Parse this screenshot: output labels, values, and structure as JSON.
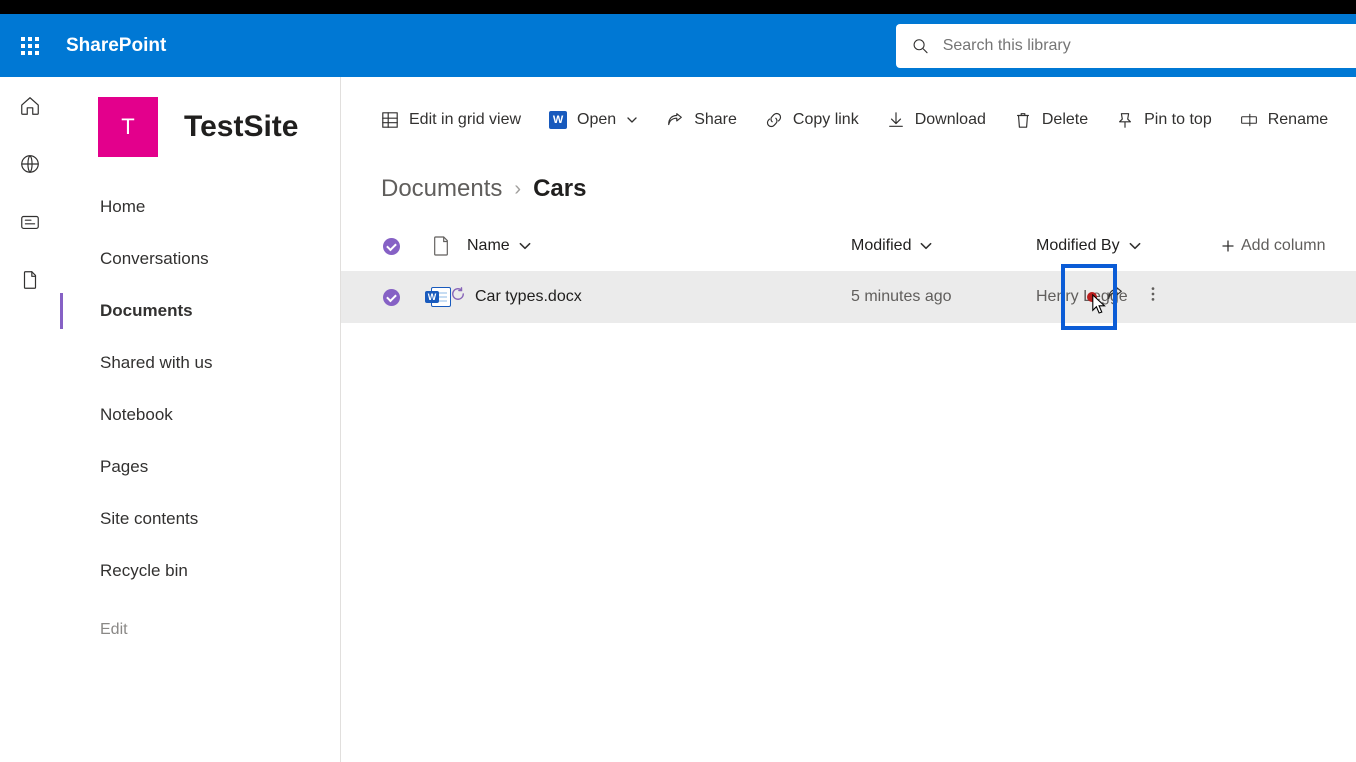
{
  "suite": {
    "brand": "SharePoint",
    "search_placeholder": "Search this library"
  },
  "site": {
    "logo_letter": "T",
    "title": "TestSite"
  },
  "nav": {
    "items": [
      {
        "label": "Home"
      },
      {
        "label": "Conversations"
      },
      {
        "label": "Documents"
      },
      {
        "label": "Shared with us"
      },
      {
        "label": "Notebook"
      },
      {
        "label": "Pages"
      },
      {
        "label": "Site contents"
      },
      {
        "label": "Recycle bin"
      }
    ],
    "edit": "Edit"
  },
  "commands": {
    "edit_grid": "Edit in grid view",
    "open": "Open",
    "share": "Share",
    "copy_link": "Copy link",
    "download": "Download",
    "delete": "Delete",
    "pin": "Pin to top",
    "rename": "Rename"
  },
  "breadcrumb": {
    "root": "Documents",
    "leaf": "Cars"
  },
  "columns": {
    "name": "Name",
    "modified": "Modified",
    "modified_by": "Modified By",
    "add": "Add column"
  },
  "rows": [
    {
      "name": "Car types.docx",
      "modified": "5 minutes ago",
      "modified_by": "Henry Legge"
    }
  ]
}
